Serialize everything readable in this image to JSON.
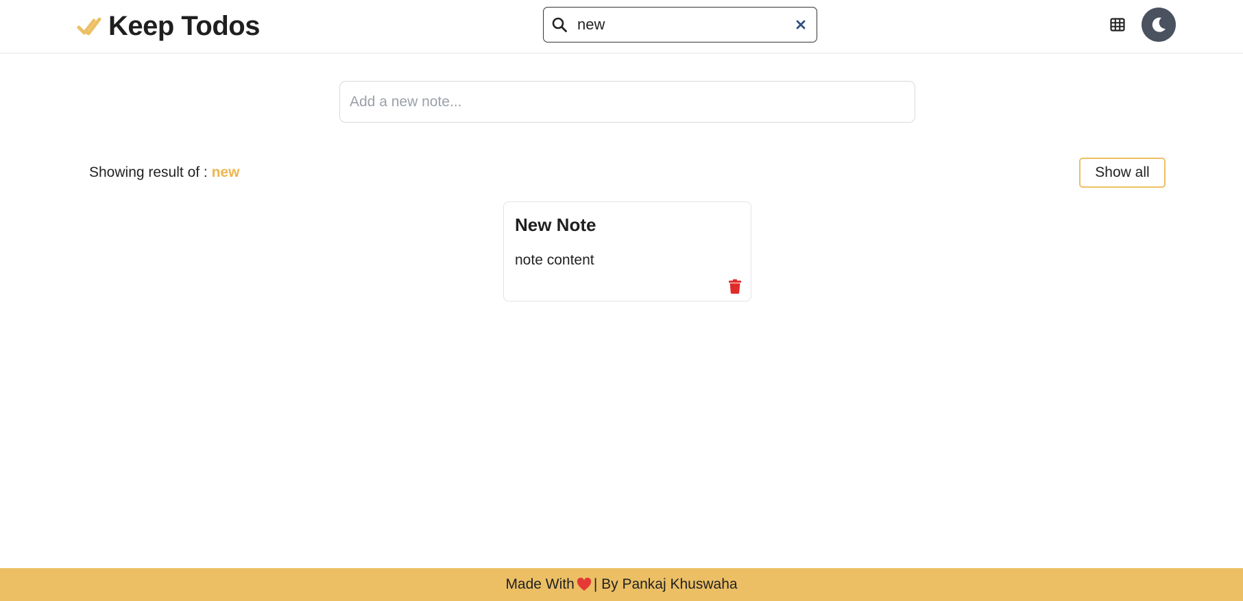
{
  "header": {
    "brand_title": "Keep Todos",
    "search": {
      "value": "new",
      "placeholder": "",
      "clear_icon": "close-icon"
    },
    "grid_toggle_icon": "grid-icon",
    "theme_toggle_icon": "moon-icon"
  },
  "composer": {
    "placeholder": "Add a new note..."
  },
  "results": {
    "prefix": "Showing result of : ",
    "term": "new",
    "show_all_label": "Show all"
  },
  "notes": [
    {
      "title": "New Note",
      "content": "note content"
    }
  ],
  "footer": {
    "made_with": "Made With",
    "by": "| By Pankaj Khuswaha"
  },
  "colors": {
    "accent": "#edb64f",
    "footer_bg": "#ecbf65",
    "theme_button": "#4a5260",
    "delete": "#e02b2b",
    "heart": "#e53935",
    "clear_icon": "#2f4f7f"
  }
}
